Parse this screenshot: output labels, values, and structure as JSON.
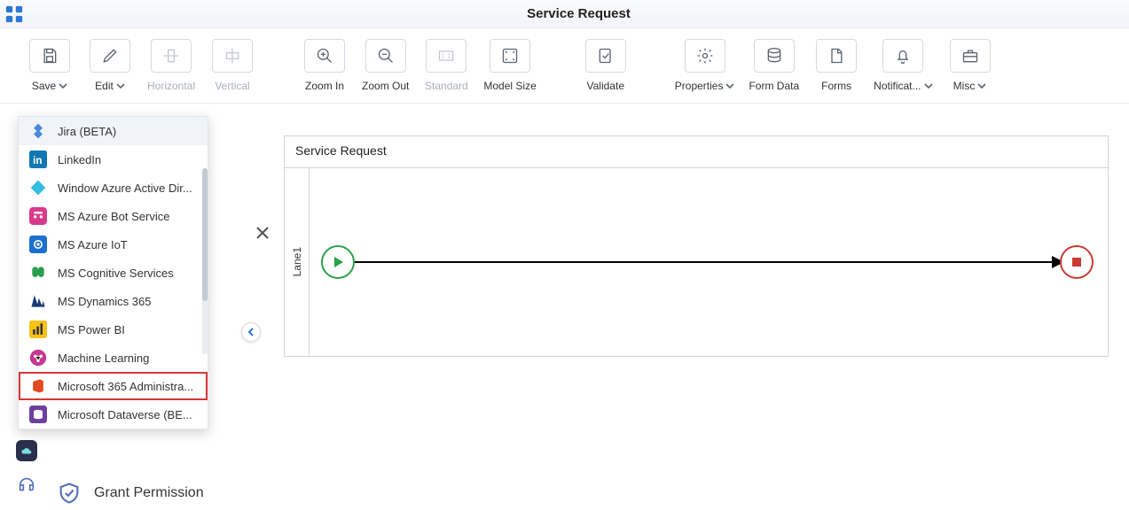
{
  "header": {
    "title": "Service Request"
  },
  "toolbar": {
    "save": "Save",
    "edit": "Edit",
    "horizontal": "Horizontal",
    "vertical": "Vertical",
    "zoom_in": "Zoom In",
    "zoom_out": "Zoom Out",
    "standard": "Standard",
    "model_size": "Model Size",
    "validate": "Validate",
    "properties": "Properties",
    "form_data": "Form Data",
    "forms": "Forms",
    "notifications": "Notificat...",
    "misc": "Misc"
  },
  "dropdown": {
    "items": [
      {
        "label": "Jira (BETA)"
      },
      {
        "label": "LinkedIn"
      },
      {
        "label": "Window Azure Active Dir..."
      },
      {
        "label": "MS Azure Bot Service"
      },
      {
        "label": "MS Azure IoT"
      },
      {
        "label": "MS Cognitive Services"
      },
      {
        "label": "MS Dynamics 365"
      },
      {
        "label": "MS Power BI"
      },
      {
        "label": "Machine Learning"
      },
      {
        "label": "Microsoft 365 Administra..."
      },
      {
        "label": "Microsoft Dataverse (BE..."
      }
    ],
    "highlighted_index": 9
  },
  "side": {
    "grant_permission": "Grant Permission"
  },
  "canvas": {
    "title": "Service Request",
    "lane": "Lane1"
  }
}
